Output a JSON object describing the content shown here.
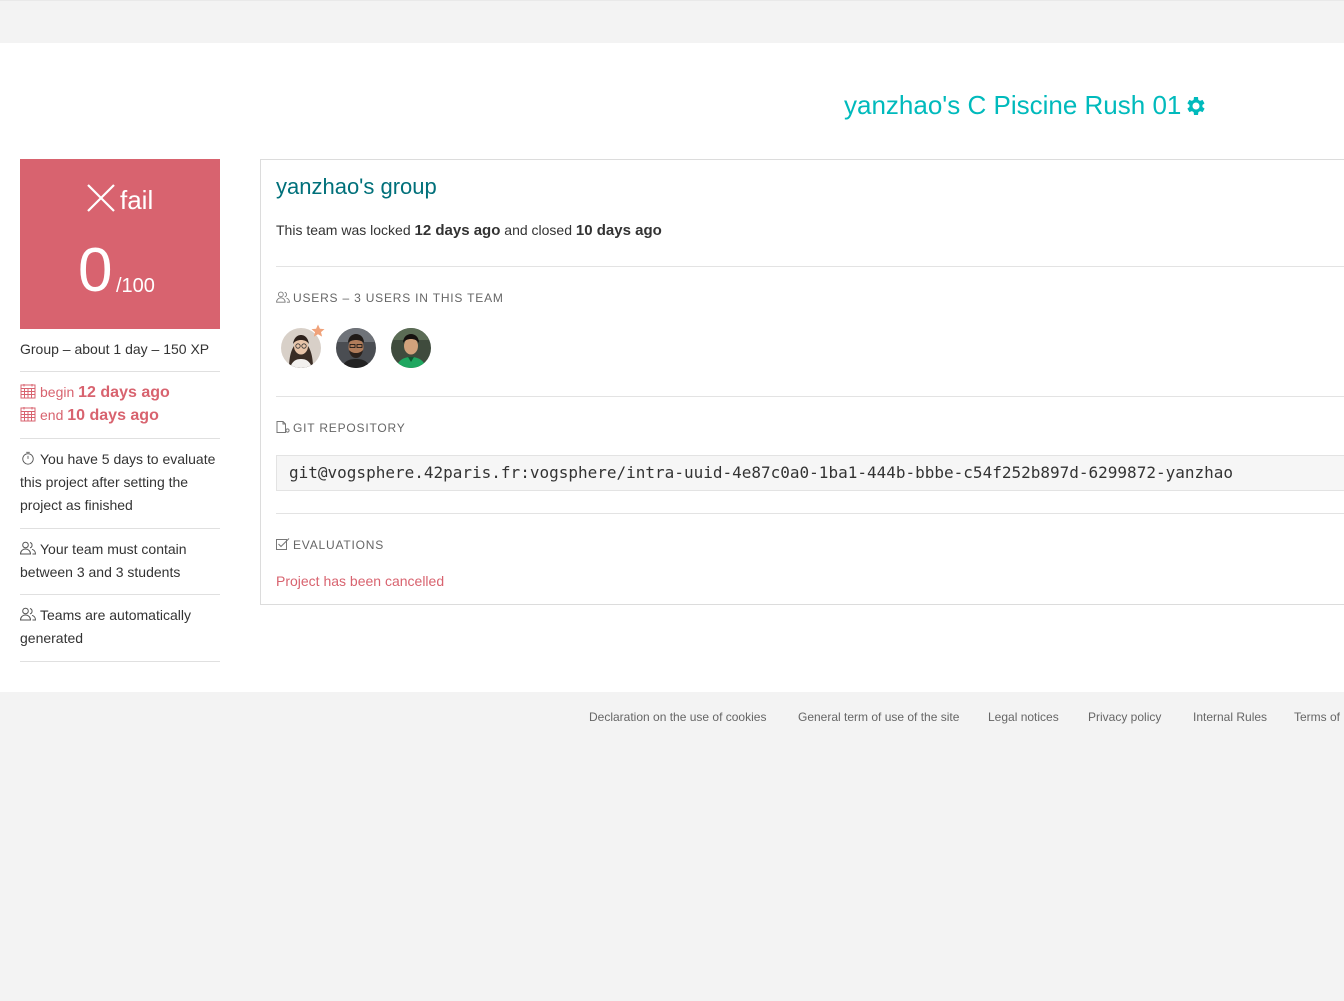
{
  "header": {
    "project_title": "yanzhao's C Piscine Rush 01",
    "settings_icon": "gear-icon",
    "accent_color": "#00babc"
  },
  "grade": {
    "status_icon": "close-icon",
    "status": "fail",
    "score": "0",
    "max": "/100",
    "color": "#d8636f"
  },
  "sidebar": {
    "summary": "Group – about 1 day – 150 XP",
    "begin_label": "begin",
    "begin_value": "12 days ago",
    "end_label": "end",
    "end_value": "10 days ago",
    "evaluate_note": "You have 5 days to evaluate this project after setting the project as finished",
    "team_size_note": "Your team must contain between 3 and 3 students",
    "auto_teams_note": "Teams are automatically generated"
  },
  "team": {
    "name": "yanzhao's group",
    "locked_prefix": "This team was locked",
    "locked_value": "12 days ago",
    "closed_prefix": "and closed",
    "closed_value": "10 days ago",
    "users_title": "Users – 3 users in this team",
    "members": [
      {
        "avatar_name": "avatar-leader",
        "leader": true
      },
      {
        "avatar_name": "avatar-member-2",
        "leader": false
      },
      {
        "avatar_name": "avatar-member-3",
        "leader": false
      }
    ],
    "git_title": "Git repository",
    "git_url": "git@vogsphere.42paris.fr:vogsphere/intra-uuid-4e87c0a0-1ba1-444b-bbbe-c54f252b897d-6299872-yanzhao",
    "evaluations_title": "Evaluations",
    "evaluations_status": "Project has been cancelled"
  },
  "footer": {
    "links": [
      "Declaration on the use of cookies",
      "General term of use of the site",
      "Legal notices",
      "Privacy policy",
      "Internal Rules",
      "Terms of use"
    ]
  }
}
